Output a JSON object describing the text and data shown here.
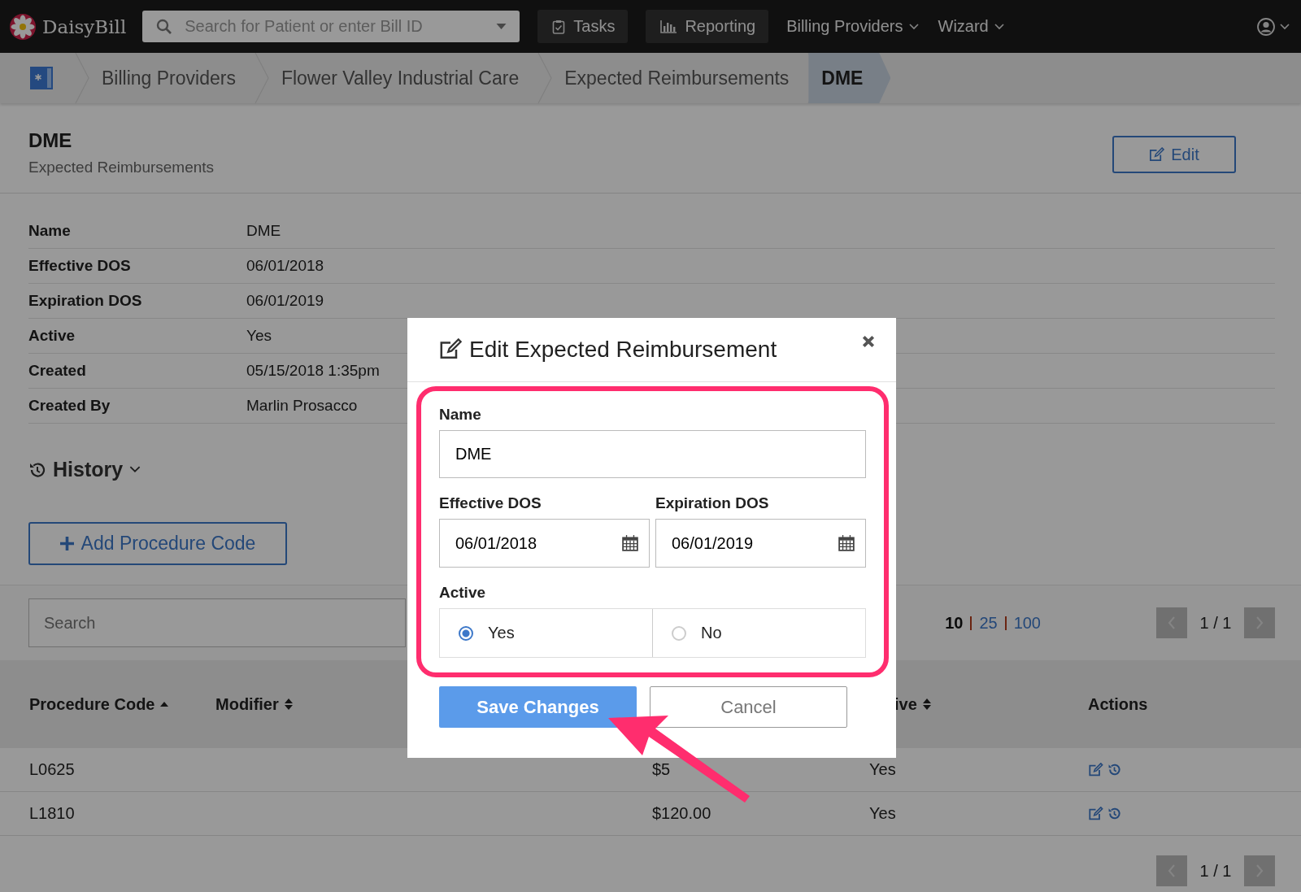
{
  "navbar": {
    "logo": "DaisyBill",
    "search": {
      "placeholder": "Search for Patient or enter Bill ID"
    },
    "items": [
      {
        "label": "Tasks",
        "kind": "button"
      },
      {
        "label": "Reporting",
        "kind": "button"
      },
      {
        "label": "Billing Providers",
        "kind": "menu"
      },
      {
        "label": "Wizard",
        "kind": "menu"
      }
    ]
  },
  "breadcrumbs": [
    {
      "label": "Billing Providers",
      "selected": false
    },
    {
      "label": "Flower Valley Industrial Care",
      "selected": false
    },
    {
      "label": "Expected Reimbursements",
      "selected": false
    },
    {
      "label": "DME",
      "selected": true
    }
  ],
  "header": {
    "title": "DME",
    "subtitle": "Expected Reimbursements",
    "edit_button": "Edit"
  },
  "details": [
    {
      "label": "Name",
      "value": "DME"
    },
    {
      "label": "Effective DOS",
      "value": "06/01/2018"
    },
    {
      "label": "Expiration DOS",
      "value": "06/01/2019"
    },
    {
      "label": "Active",
      "value": "Yes"
    },
    {
      "label": "Created",
      "value": "05/15/2018 1:35pm"
    },
    {
      "label": "Created By",
      "value": "Marlin Prosacco"
    }
  ],
  "history": {
    "label": "History",
    "expanded": false
  },
  "add_button": "Add Procedure Code",
  "table_tools": {
    "search": {
      "placeholder": "Search"
    },
    "page_sizes": [
      {
        "label": "10",
        "selected": true
      },
      {
        "label": "25",
        "selected": false
      },
      {
        "label": "100",
        "selected": false
      }
    ],
    "page": "1 / 1"
  },
  "table": {
    "columns": [
      {
        "label": "Procedure Code",
        "sortable": true,
        "sorted_ascending": true
      },
      {
        "label": "Modifier",
        "sortable": true,
        "sorted_ascending": false
      },
      {
        "label": "ive",
        "sortable": true,
        "sorted_ascending": false
      },
      {
        "label": "Actions",
        "sortable": false
      }
    ],
    "rows": [
      {
        "code": "L0625",
        "price": "$5",
        "active": "Yes"
      },
      {
        "code": "L1810",
        "price": "$120.00",
        "active": "Yes"
      }
    ]
  },
  "footer": {
    "page": "1 / 1"
  },
  "modal": {
    "title": "Edit Expected Reimbursement",
    "name": {
      "label": "Name",
      "value": "DME"
    },
    "dates": [
      {
        "label": "Effective DOS",
        "value": "06/01/2018"
      },
      {
        "label": "Expiration DOS",
        "value": "06/01/2019"
      }
    ],
    "active": {
      "label": "Active",
      "options": [
        {
          "label": "Yes",
          "selected": true
        },
        {
          "label": "No",
          "selected": false
        }
      ]
    },
    "buttons": [
      {
        "label": "Save Changes",
        "kind": "primary"
      },
      {
        "label": "Cancel",
        "kind": "secondary"
      }
    ]
  }
}
